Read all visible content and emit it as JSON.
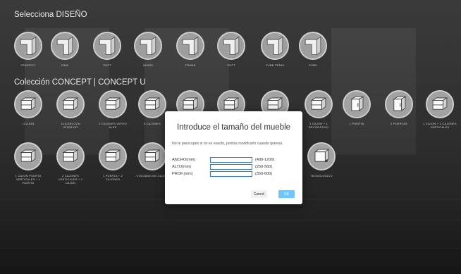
{
  "screen": {
    "design_heading": "Selecciona DISEÑO",
    "collection_heading": "Colección CONCEPT | CONCEPT U"
  },
  "design_items": [
    {
      "label": "CONCEPT",
      "icon": "handle-profile-icon"
    },
    {
      "label": "RAM",
      "icon": "handle-profile-icon"
    },
    {
      "label": "SOFT",
      "icon": "handle-profile-icon"
    },
    {
      "label": "INSIDE",
      "icon": "handle-profile-icon"
    },
    {
      "label": "FRAME",
      "icon": "handle-profile-icon"
    },
    {
      "label": "SOFT",
      "icon": "handle-profile-icon"
    },
    {
      "label": "PURE PENIS",
      "icon": "handle-profile-icon"
    },
    {
      "label": "PURE",
      "icon": "handle-profile-icon"
    }
  ],
  "collection_row1": [
    {
      "label": "1CAJON",
      "icon": "drawer-cabinet-icon"
    },
    {
      "label": "1CAJON CON INTERIOR",
      "icon": "drawer-cabinet-icon"
    },
    {
      "label": "2 CAJONES VERTO ALES",
      "icon": "drawer-cabinet-icon"
    },
    {
      "label": "3 CAJONES",
      "icon": "drawer-cabinet-icon"
    },
    {
      "label": "",
      "icon": "drawer-cabinet-icon"
    },
    {
      "label": "",
      "icon": "drawer-cabinet-icon"
    },
    {
      "label": "",
      "icon": "drawer-cabinet-icon"
    },
    {
      "label": "1 CAJON + 1 DECORATIVO",
      "icon": "drawer-cabinet-icon"
    },
    {
      "label": "1 PUERTA",
      "icon": "door-cabinet-icon"
    },
    {
      "label": "2 PUERTAS",
      "icon": "door-cabinet-icon"
    },
    {
      "label": "1 CAJON + 2 CAJONES VERTICALES",
      "icon": "drawer-cabinet-icon"
    }
  ],
  "collection_row2": [
    {
      "label": "1 CAJON PUERTA VERTICALES + 1 PUERTA",
      "icon": "drawer-cabinet-icon"
    },
    {
      "label": "2 CAJONES VERTICALES + 1 CAJON",
      "icon": "drawer-cabinet-icon"
    },
    {
      "label": "1 PUERTA + 2 CAJONES",
      "icon": "drawer-cabinet-icon"
    },
    {
      "label": "COLGADO NO CAJON",
      "icon": "drawer-cabinet-icon"
    },
    {
      "label": "TECNOLOGICO",
      "icon": "tech-cabinet-icon"
    }
  ],
  "modal": {
    "title": "Introduce el tamaño del mueble",
    "description": "No te preocupes si no es exacto, podrás modificarlo cuando quieras.",
    "fields": [
      {
        "label": "ANCHO(mm)",
        "value": "",
        "range": "(400-1200)"
      },
      {
        "label": "ALTO(mm)",
        "value": "",
        "range": "(250-560)"
      },
      {
        "label": "PROF.(mm)",
        "value": "",
        "range": "(350-600)"
      }
    ],
    "cancel_label": "Cancel",
    "ok_label": "OK"
  },
  "colors": {
    "accent": "#6cc6ff",
    "field_border": "#2a7fd4"
  }
}
